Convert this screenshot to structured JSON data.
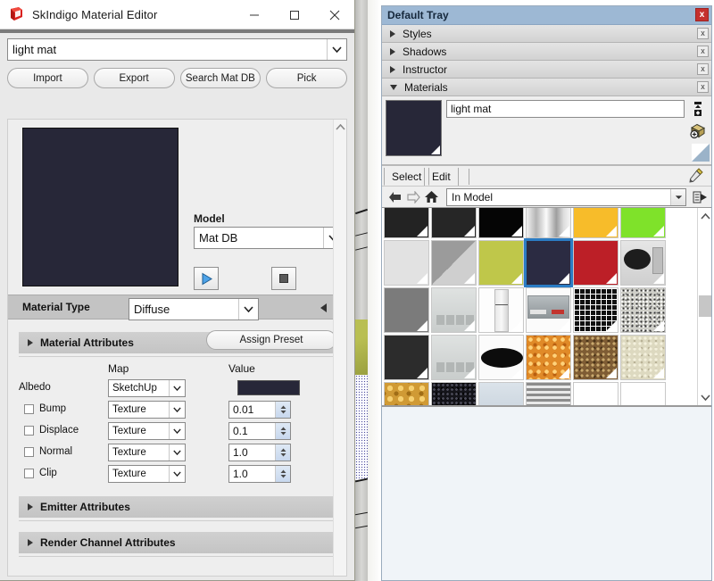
{
  "viewport": {
    "name": "sketchup-viewport"
  },
  "material_editor": {
    "title": "SkIndigo Material Editor",
    "icon": "sketchup-logo-icon",
    "window_buttons": {
      "minimize": "minimize-icon",
      "maximize": "maximize-icon",
      "close": "close-icon"
    },
    "material_name": "light mat",
    "buttons": [
      {
        "name": "import-button",
        "label": "Import"
      },
      {
        "name": "export-button",
        "label": "Export"
      },
      {
        "name": "search-mat-db-button",
        "label": "Search Mat DB"
      },
      {
        "name": "pick-button",
        "label": "Pick"
      }
    ],
    "preview": {
      "color": "#272738"
    },
    "model": {
      "label": "Model",
      "value": "Mat DB"
    },
    "playback": {
      "play": "play-icon",
      "stop": "stop-icon"
    },
    "material_type": {
      "label": "Material Type",
      "value": "Diffuse",
      "collapse": "collapse-left-arrow-icon"
    },
    "sections": [
      {
        "name": "material-attributes",
        "label": "Material Attributes",
        "expanded": true
      },
      {
        "name": "emitter-attributes",
        "label": "Emitter Attributes",
        "expanded": false
      },
      {
        "name": "render-channel-attributes",
        "label": "Render Channel Attributes",
        "expanded": false
      }
    ],
    "assign_preset_label": "Assign Preset",
    "attr_headers": {
      "map": "Map",
      "value": "Value"
    },
    "attributes": [
      {
        "name": "albedo",
        "label": "Albedo",
        "checkbox": false,
        "checked": false,
        "map": "SketchUp",
        "value": "",
        "swatch": "#272738",
        "browse": ".."
      },
      {
        "name": "bump",
        "label": "Bump",
        "checkbox": true,
        "checked": false,
        "map": "Texture",
        "value": "0.01",
        "swatch": "",
        "browse": ".."
      },
      {
        "name": "displace",
        "label": "Displace",
        "checkbox": true,
        "checked": false,
        "map": "Texture",
        "value": "0.1",
        "swatch": "",
        "browse": ".."
      },
      {
        "name": "normal",
        "label": "Normal",
        "checkbox": true,
        "checked": false,
        "map": "Texture",
        "value": "1.0",
        "swatch": "",
        "browse": ".."
      },
      {
        "name": "clip",
        "label": "Clip",
        "checkbox": true,
        "checked": false,
        "map": "Texture",
        "value": "1.0",
        "swatch": "",
        "browse": ".."
      }
    ]
  },
  "tray": {
    "title": "Default Tray",
    "close_label": "x",
    "sections": [
      {
        "name": "styles",
        "label": "Styles",
        "expanded": false,
        "close": "x"
      },
      {
        "name": "shadows",
        "label": "Shadows",
        "expanded": false,
        "close": "x"
      },
      {
        "name": "instructor",
        "label": "Instructor",
        "expanded": false,
        "close": "x"
      },
      {
        "name": "materials",
        "label": "Materials",
        "expanded": true,
        "close": "x"
      }
    ],
    "materials": {
      "current_swatch_color": "#272738",
      "current_name": "light mat",
      "tools": [
        {
          "name": "create-material-icon",
          "glyph": "create"
        },
        {
          "name": "display-secondary-selection-icon",
          "glyph": "paint"
        }
      ],
      "eyedropper": "eyedropper-icon",
      "tabs": [
        {
          "name": "tab-select",
          "label": "Select",
          "active": true
        },
        {
          "name": "tab-edit",
          "label": "Edit",
          "active": false
        }
      ],
      "nav": {
        "back": "back-arrow-icon",
        "forward": "forward-arrow-icon",
        "home": "home-icon",
        "library": "In Model",
        "details": "details-arrow-icon"
      },
      "grid_swatches": [
        {
          "name": "swatch-dark-charcoal-1",
          "color": "#232323",
          "kind": "solid"
        },
        {
          "name": "swatch-dark-charcoal-2",
          "color": "#262626",
          "kind": "solid"
        },
        {
          "name": "swatch-black",
          "color": "#050505",
          "kind": "solid"
        },
        {
          "name": "swatch-brushed-metal",
          "color": "#c9c9c9",
          "kind": "metal"
        },
        {
          "name": "swatch-amber-yellow",
          "color": "#f7bc2a",
          "kind": "solid"
        },
        {
          "name": "swatch-lime-green",
          "color": "#7fe22a",
          "kind": "solid"
        },
        {
          "name": "swatch-light-grey",
          "color": "#e2e2e2",
          "kind": "solid"
        },
        {
          "name": "swatch-two-tone-grey",
          "color": "#9b9b9b",
          "kind": "diagonal"
        },
        {
          "name": "swatch-olive-green",
          "color": "#bfc74a",
          "kind": "solid"
        },
        {
          "name": "swatch-light-mat-navy",
          "color": "#2b2b42",
          "kind": "solid",
          "selected": true
        },
        {
          "name": "swatch-crimson-red",
          "color": "#bc1f27",
          "kind": "solid"
        },
        {
          "name": "swatch-microwave-texture",
          "color": "#d8d8d8",
          "kind": "microwave"
        },
        {
          "name": "swatch-medium-grey",
          "color": "#7b7b7b",
          "kind": "solid"
        },
        {
          "name": "swatch-cabinet-front",
          "color": "#d2d5d4",
          "kind": "cabinet"
        },
        {
          "name": "swatch-fridge-door",
          "color": "#f2f2f2",
          "kind": "fridge"
        },
        {
          "name": "swatch-oven-front",
          "color": "#b9bcbd",
          "kind": "oven"
        },
        {
          "name": "swatch-black-grid-tile",
          "color": "#111111",
          "kind": "grid"
        },
        {
          "name": "swatch-speckled-granite",
          "color": "#c8c8c2",
          "kind": "speckle"
        },
        {
          "name": "swatch-dark-slate",
          "color": "#2c2c2c",
          "kind": "solid"
        },
        {
          "name": "swatch-cabinet-front-2",
          "color": "#d2d5d4",
          "kind": "cabinet"
        },
        {
          "name": "swatch-black-ellipse-hob",
          "color": "#fbfbfb",
          "kind": "ellipse"
        },
        {
          "name": "swatch-orange-pasta",
          "color": "#e08a28",
          "kind": "pasta"
        },
        {
          "name": "swatch-brown-grain",
          "color": "#7e5c34",
          "kind": "grain"
        },
        {
          "name": "swatch-beige-rice",
          "color": "#ddd9c0",
          "kind": "rice"
        },
        {
          "name": "swatch-fusilli-pasta",
          "color": "#d09a35",
          "kind": "fusilli"
        },
        {
          "name": "swatch-black-seeds",
          "color": "#1c1c22",
          "kind": "seeds"
        },
        {
          "name": "swatch-pale-blue-stone",
          "color": "#ccd6e0",
          "kind": "stone"
        },
        {
          "name": "swatch-striped-metal",
          "color": "#b0b0b0",
          "kind": "stripes"
        },
        {
          "name": "swatch-blank-1",
          "color": "#ffffff",
          "kind": "solid"
        },
        {
          "name": "swatch-blank-2",
          "color": "#ffffff",
          "kind": "solid"
        }
      ],
      "scroll": {
        "up": "scroll-up-icon",
        "down": "scroll-down-icon"
      }
    }
  },
  "colors": {
    "accent_blue": "#2b7cc4",
    "tray_title_bg": "#9db8d4",
    "close_red": "#c5302e",
    "material_navy": "#272738"
  }
}
